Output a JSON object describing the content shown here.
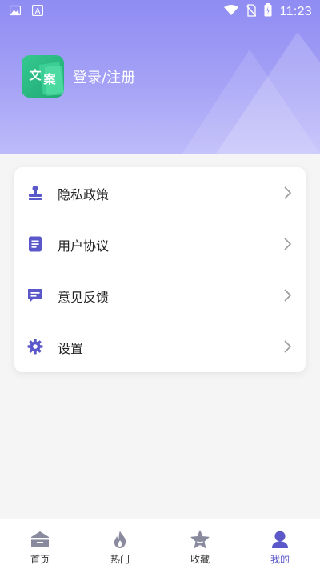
{
  "status_bar": {
    "time": "11:23",
    "icons": [
      "image-icon",
      "a-badge-icon",
      "wifi-icon",
      "no-sim-icon",
      "battery-icon"
    ]
  },
  "profile": {
    "logo_text": "文案",
    "login_label": "登录/注册"
  },
  "menu": {
    "items": [
      {
        "label": "隐私政策",
        "icon": "stamp-icon"
      },
      {
        "label": "用户协议",
        "icon": "document-icon"
      },
      {
        "label": "意见反馈",
        "icon": "feedback-icon"
      },
      {
        "label": "设置",
        "icon": "gear-icon"
      }
    ]
  },
  "tabbar": {
    "tabs": [
      {
        "label": "首页",
        "icon": "home-icon",
        "active": false
      },
      {
        "label": "热门",
        "icon": "fire-icon",
        "active": false
      },
      {
        "label": "收藏",
        "icon": "star-icon",
        "active": false
      },
      {
        "label": "我的",
        "icon": "person-icon",
        "active": true
      }
    ]
  },
  "colors": {
    "header_gradient_top": "#8f8cf3",
    "accent": "#5b58c9",
    "logo_green": "#2cbf87",
    "inactive_icon": "#8a8a9e"
  }
}
